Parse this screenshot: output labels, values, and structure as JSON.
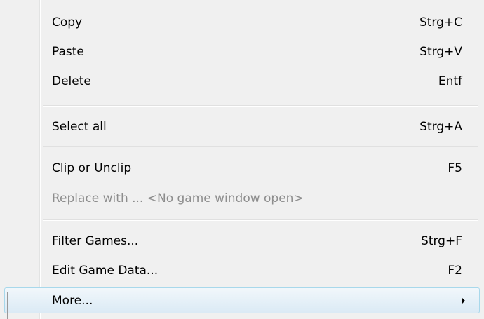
{
  "menu": {
    "items": [
      {
        "label": "Copy",
        "shortcut": "Strg+C",
        "disabled": false
      },
      {
        "label": "Paste",
        "shortcut": "Strg+V",
        "disabled": false
      },
      {
        "label": "Delete",
        "shortcut": "Entf",
        "disabled": false
      },
      {
        "label": "Select all",
        "shortcut": "Strg+A",
        "disabled": false
      },
      {
        "label": "Clip or Unclip",
        "shortcut": "F5",
        "disabled": false
      },
      {
        "label": "Replace with ... <No game window open>",
        "shortcut": "",
        "disabled": true
      },
      {
        "label": "Filter Games...",
        "shortcut": "Strg+F",
        "disabled": false
      },
      {
        "label": "Edit Game Data...",
        "shortcut": "F2",
        "disabled": false
      },
      {
        "label": "More...",
        "shortcut": "",
        "disabled": false,
        "submenu": true,
        "highlighted": true
      }
    ],
    "submenu_arrow_icon": "chevron-right-icon",
    "colors": {
      "background": "#f0f0f0",
      "disabled_text": "#8d8d8d",
      "highlight_border": "#a8d8eb",
      "highlight_fill": "#dbeaf5"
    }
  }
}
